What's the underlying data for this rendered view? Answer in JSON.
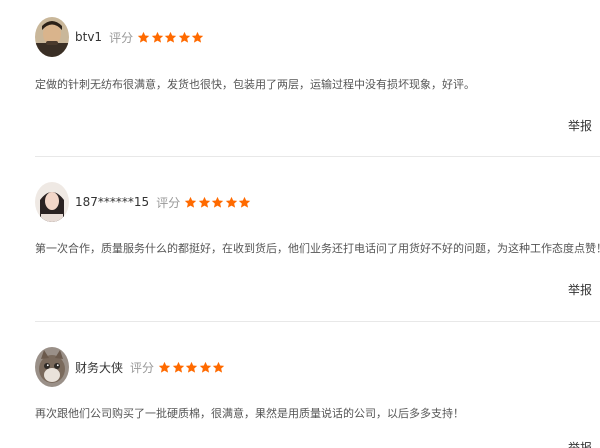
{
  "colors": {
    "star": "#ff6a00",
    "divider": "#e8e8e8",
    "text": "#333333",
    "muted": "#999999"
  },
  "reviews": [
    {
      "username": "btv1",
      "rating_label": "评分",
      "stars": 5,
      "comment": "定做的针刺无纺布很满意，发货也很快，包装用了两层，运输过程中没有损坏现象，好评。",
      "report_label": "举报"
    },
    {
      "username": "187******15",
      "rating_label": "评分",
      "stars": 5,
      "comment": "第一次合作，质量服务什么的都挺好，在收到货后，他们业务还打电话问了用货好不好的问题，为这种工作态度点赞！",
      "report_label": "举报"
    },
    {
      "username": "财务大侠",
      "rating_label": "评分",
      "stars": 5,
      "comment": "再次跟他们公司购买了一批硬质棉，很满意，果然是用质量说话的公司，以后多多支持！",
      "report_label": "举报"
    }
  ]
}
